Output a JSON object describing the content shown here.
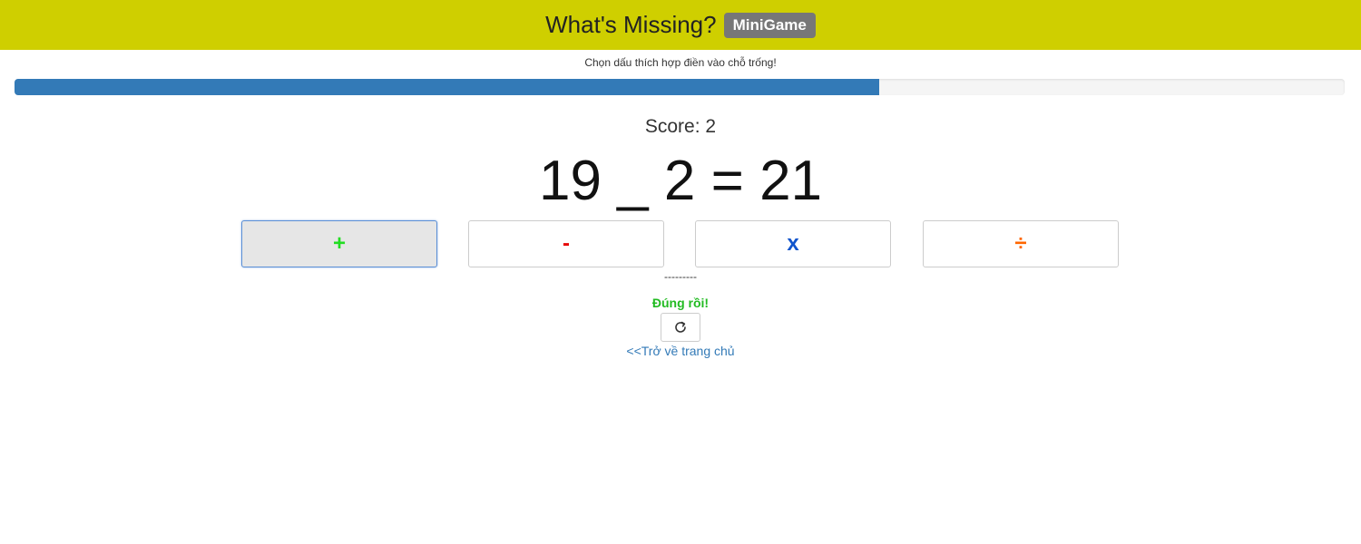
{
  "header": {
    "title": "What's Missing?",
    "badge": "MiniGame",
    "background_color": "#cfcf00"
  },
  "instruction": "Chọn dấu thích hợp điền vào chỗ trống!",
  "progress": {
    "fraction": 0.65,
    "fill_color": "#337ab7"
  },
  "score": {
    "label": "Score:",
    "value": "2"
  },
  "equation": {
    "left_operand": "19",
    "blank": "_",
    "right_operand": "2",
    "equals": "=",
    "result": "21"
  },
  "answers": [
    {
      "label": "+",
      "color": "#22dd22",
      "selected": true
    },
    {
      "label": "-",
      "color": "#e60000",
      "selected": false
    },
    {
      "label": "x",
      "color": "#1155cc",
      "selected": false
    },
    {
      "label": "÷",
      "color": "#ff6600",
      "selected": false
    }
  ],
  "separator": "---------",
  "result_message": "Đúng rồi!",
  "reset_icon": "refresh-icon",
  "home_link": "<<Trở về trang chủ"
}
